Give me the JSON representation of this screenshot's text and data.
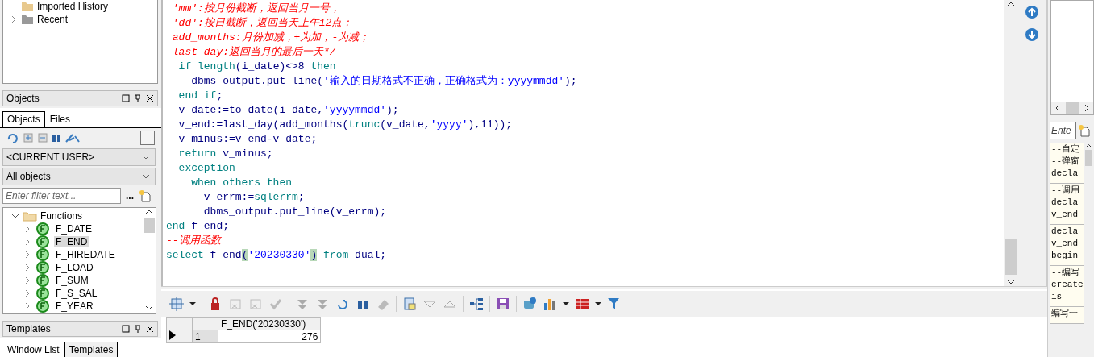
{
  "history_tree": [
    {
      "label": "Imported History",
      "kind": "leaf"
    },
    {
      "label": "Recent",
      "kind": "node"
    }
  ],
  "objects_panel": {
    "title": "Objects",
    "tabs": [
      {
        "label": "Objects",
        "selected": true
      },
      {
        "label": "Files",
        "selected": false
      }
    ],
    "dropdowns": [
      "<CURRENT USER>",
      "All objects"
    ],
    "filter": {
      "placeholder": "Enter filter text..."
    },
    "more": "...",
    "tree": [
      {
        "label": "Functions",
        "expanded": true,
        "children": [
          {
            "label": "F_DATE",
            "selected": false
          },
          {
            "label": "F_END",
            "selected": true
          },
          {
            "label": "F_HIREDATE",
            "selected": false
          },
          {
            "label": "F_LOAD",
            "selected": false
          },
          {
            "label": "F_SUM",
            "selected": false
          },
          {
            "label": "F_S_SAL",
            "selected": false
          },
          {
            "label": "F_YEAR",
            "selected": false
          }
        ]
      }
    ]
  },
  "templates_panel": {
    "title": "Templates",
    "tabs": [
      {
        "label": "Window List",
        "selected": false
      },
      {
        "label": "Templates",
        "selected": true
      }
    ]
  },
  "editor": {
    "lines": [
      {
        "tokens": [
          {
            "kind": "comment",
            "text": " 'mm':按月份截断，返回当月一号，"
          }
        ]
      },
      {
        "tokens": [
          {
            "kind": "comment",
            "text": " 'dd':按日截断，返回当天上午12点；"
          }
        ]
      },
      {
        "tokens": [
          {
            "kind": "comment",
            "text": " add_months:月份加减，+为加，-为减；"
          }
        ]
      },
      {
        "tokens": [
          {
            "kind": "comment",
            "text": " last_day:返回当月的最后一天*/"
          }
        ]
      },
      {
        "tokens": [
          {
            "kind": "keyword",
            "text": "  if "
          },
          {
            "kind": "keyword",
            "text": "length"
          },
          {
            "kind": "plain",
            "text": "(i_date)<>8 "
          },
          {
            "kind": "keyword",
            "text": "then"
          }
        ]
      },
      {
        "tokens": [
          {
            "kind": "plain",
            "text": "    dbms_output.put_line("
          },
          {
            "kind": "string",
            "text": "'输入的日期格式不正确，正确格式为：yyyymmdd'"
          },
          {
            "kind": "plain",
            "text": ");"
          }
        ]
      },
      {
        "tokens": [
          {
            "kind": "keyword",
            "text": "  end if"
          },
          {
            "kind": "plain",
            "text": ";"
          }
        ]
      },
      {
        "tokens": [
          {
            "kind": "plain",
            "text": "  v_date:=to_date(i_date,"
          },
          {
            "kind": "string",
            "text": "'yyyymmdd'"
          },
          {
            "kind": "plain",
            "text": ");"
          }
        ]
      },
      {
        "tokens": [
          {
            "kind": "plain",
            "text": "  v_end:=last_day(add_months("
          },
          {
            "kind": "keyword",
            "text": "trunc"
          },
          {
            "kind": "plain",
            "text": "(v_date,"
          },
          {
            "kind": "string",
            "text": "'yyyy'"
          },
          {
            "kind": "plain",
            "text": "),11));"
          }
        ]
      },
      {
        "tokens": [
          {
            "kind": "plain",
            "text": "  v_minus:=v_end-v_date;"
          }
        ]
      },
      {
        "tokens": [
          {
            "kind": "keyword",
            "text": "  return "
          },
          {
            "kind": "plain",
            "text": "v_minus;"
          }
        ]
      },
      {
        "tokens": [
          {
            "kind": "keyword",
            "text": "  exception"
          }
        ]
      },
      {
        "tokens": [
          {
            "kind": "keyword",
            "text": "    when others then"
          }
        ]
      },
      {
        "tokens": [
          {
            "kind": "plain",
            "text": "      v_errm:="
          },
          {
            "kind": "keyword",
            "text": "sqlerrm"
          },
          {
            "kind": "plain",
            "text": ";"
          }
        ]
      },
      {
        "tokens": [
          {
            "kind": "plain",
            "text": "      dbms_output.put_line(v_errm);"
          }
        ]
      },
      {
        "tokens": [
          {
            "kind": "keyword",
            "text": "end "
          },
          {
            "kind": "plain",
            "text": "f_end;"
          }
        ]
      },
      {
        "tokens": [
          {
            "kind": "comment",
            "text": "--调用函数"
          }
        ]
      },
      {
        "tokens": [
          {
            "kind": "keyword",
            "text": "select "
          },
          {
            "kind": "plain",
            "text": "f_end"
          },
          {
            "kind": "match",
            "text": "("
          },
          {
            "kind": "string",
            "text": "'20230330'"
          },
          {
            "kind": "match",
            "text": ")"
          },
          {
            "kind": "keyword",
            "text": " from "
          },
          {
            "kind": "plain",
            "text": "dual;"
          }
        ]
      }
    ]
  },
  "results": {
    "columns": [
      "F_END('20230330')"
    ],
    "rows": [
      {
        "number": "1",
        "current": true,
        "cells": [
          "276"
        ]
      }
    ]
  },
  "snippets": [
    {
      "lines": [
        "--自定",
        "--弹窗",
        "decla"
      ]
    },
    {
      "lines": [
        "--调用",
        "decla",
        "v_end"
      ]
    },
    {
      "lines": [
        "decla",
        "v_end",
        "begin"
      ]
    },
    {
      "lines": [
        "--编写",
        "create",
        "is"
      ]
    },
    {
      "lines": [
        "编写一"
      ]
    }
  ],
  "snippet_filter": {
    "placeholder": "Ente"
  }
}
